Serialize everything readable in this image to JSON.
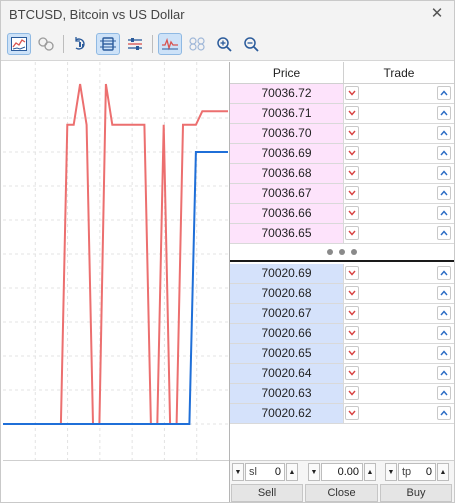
{
  "window": {
    "title": "BTCUSD, Bitcoin vs US Dollar",
    "close_symbol": "✕"
  },
  "toolbar": {
    "icons": [
      "chart-icon",
      "trade-levels-icon",
      "volume-icon",
      "depth-of-market-icon",
      "ticks-list-icon",
      "tick-chart-icon",
      "alt-chart-icon",
      "zoom-in-icon",
      "zoom-out-icon"
    ]
  },
  "dom": {
    "headers": {
      "price": "Price",
      "trade": "Trade"
    },
    "asks": [
      "70036.72",
      "70036.71",
      "70036.70",
      "70036.69",
      "70036.68",
      "70036.67",
      "70036.66",
      "70036.65"
    ],
    "bids": [
      "70020.69",
      "70020.68",
      "70020.67",
      "70020.66",
      "70020.65",
      "70020.64",
      "70020.63",
      "70020.62"
    ]
  },
  "controls": {
    "sl_label": "sl",
    "sl_value": "0",
    "volume_value": "0.00",
    "tp_label": "tp",
    "tp_value": "0",
    "sell_label": "Sell",
    "close_label": "Close",
    "buy_label": "Buy"
  },
  "colors": {
    "ask_line": "#ec6f6f",
    "bid_line": "#1f6fd8",
    "ask_bg": "#fde3fb",
    "bid_bg": "#d5e2fb"
  },
  "chart_data": {
    "type": "line",
    "series": [
      {
        "color": "#ec6f6f",
        "values": [
          0.0,
          0.0,
          0.0,
          0.0,
          0.0,
          0.0,
          0.0,
          0.0,
          0.0,
          0.0,
          0.88,
          0.88,
          1.0,
          0.88,
          0.0,
          0.0,
          1.0,
          0.88,
          0.88,
          0.88,
          0.88,
          0.88,
          0.88,
          0.0,
          0.0,
          0.88,
          0.0,
          0.0,
          0.88,
          0.88,
          0.88,
          0.92,
          0.92,
          0.92,
          0.92,
          0.92
        ]
      },
      {
        "color": "#1f6fd8",
        "values": [
          0.0,
          0.0,
          0.0,
          0.0,
          0.0,
          0.0,
          0.0,
          0.0,
          0.0,
          0.0,
          0.0,
          0.0,
          0.0,
          0.0,
          0.0,
          0.0,
          0.0,
          0.0,
          0.0,
          0.0,
          0.0,
          0.0,
          0.0,
          0.0,
          0.0,
          0.0,
          0.0,
          0.0,
          0.0,
          0.0,
          0.8,
          0.8,
          0.8,
          0.8,
          0.8,
          0.8
        ]
      }
    ],
    "ylim": [
      0,
      1
    ],
    "grid": true
  }
}
